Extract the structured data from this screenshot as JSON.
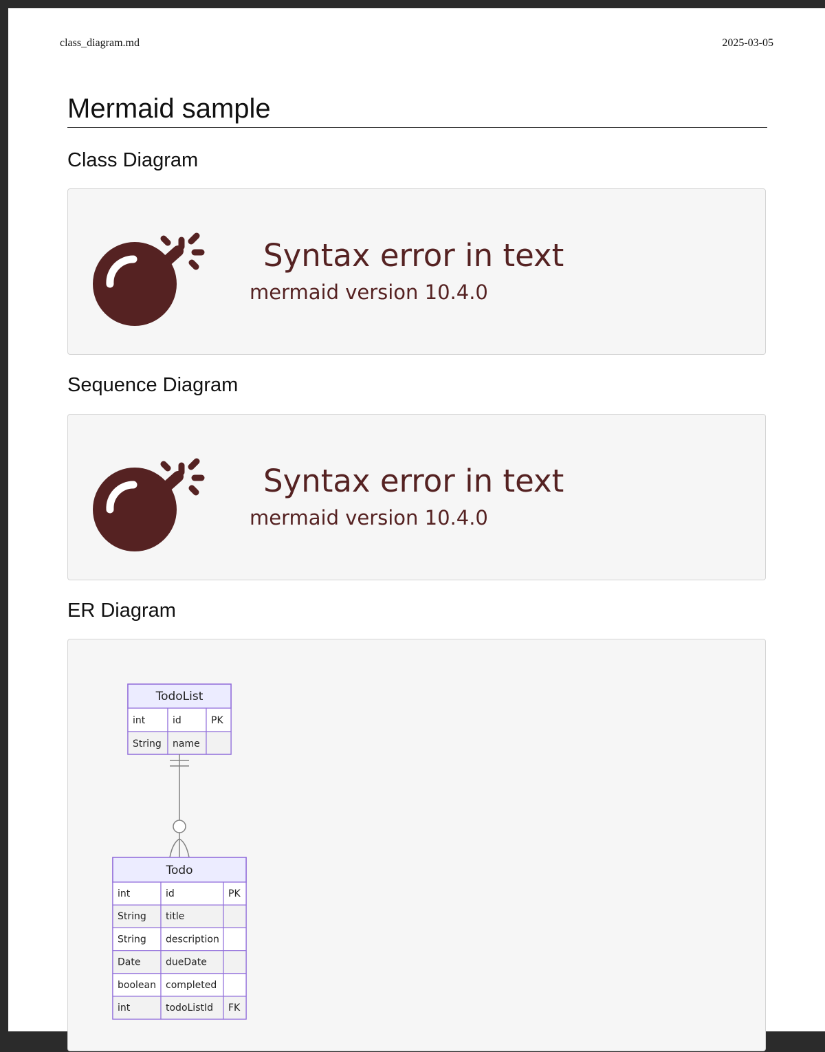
{
  "header": {
    "filename": "class_diagram.md",
    "date": "2025-03-05"
  },
  "page_title": "Mermaid sample",
  "sections": [
    {
      "heading": "Class Diagram",
      "error": {
        "title": "Syntax error in text",
        "version": "mermaid version 10.4.0"
      },
      "icon": "bomb-icon"
    },
    {
      "heading": "Sequence Diagram",
      "error": {
        "title": "Syntax error in text",
        "version": "mermaid version 10.4.0"
      },
      "icon": "bomb-icon"
    },
    {
      "heading": "ER Diagram"
    }
  ],
  "er_diagram": {
    "entities": [
      {
        "name": "TodoList",
        "attributes": [
          {
            "type": "int",
            "name": "id",
            "key": "PK"
          },
          {
            "type": "String",
            "name": "name",
            "key": ""
          }
        ]
      },
      {
        "name": "Todo",
        "attributes": [
          {
            "type": "int",
            "name": "id",
            "key": "PK"
          },
          {
            "type": "String",
            "name": "title",
            "key": ""
          },
          {
            "type": "String",
            "name": "description",
            "key": ""
          },
          {
            "type": "Date",
            "name": "dueDate",
            "key": ""
          },
          {
            "type": "boolean",
            "name": "completed",
            "key": ""
          },
          {
            "type": "int",
            "name": "todoListId",
            "key": "FK"
          }
        ]
      }
    ],
    "relationship": {
      "from": "TodoList",
      "to": "Todo",
      "from_cardinality": "exactly-one",
      "to_cardinality": "zero-or-more"
    }
  },
  "colors": {
    "error": "#552222",
    "entity_border": "#9370db",
    "entity_header": "#ececff",
    "row_even": "#ffffff",
    "row_odd": "#f2f2f2",
    "box_background": "#f6f6f6",
    "relationship_line": "#808080"
  }
}
